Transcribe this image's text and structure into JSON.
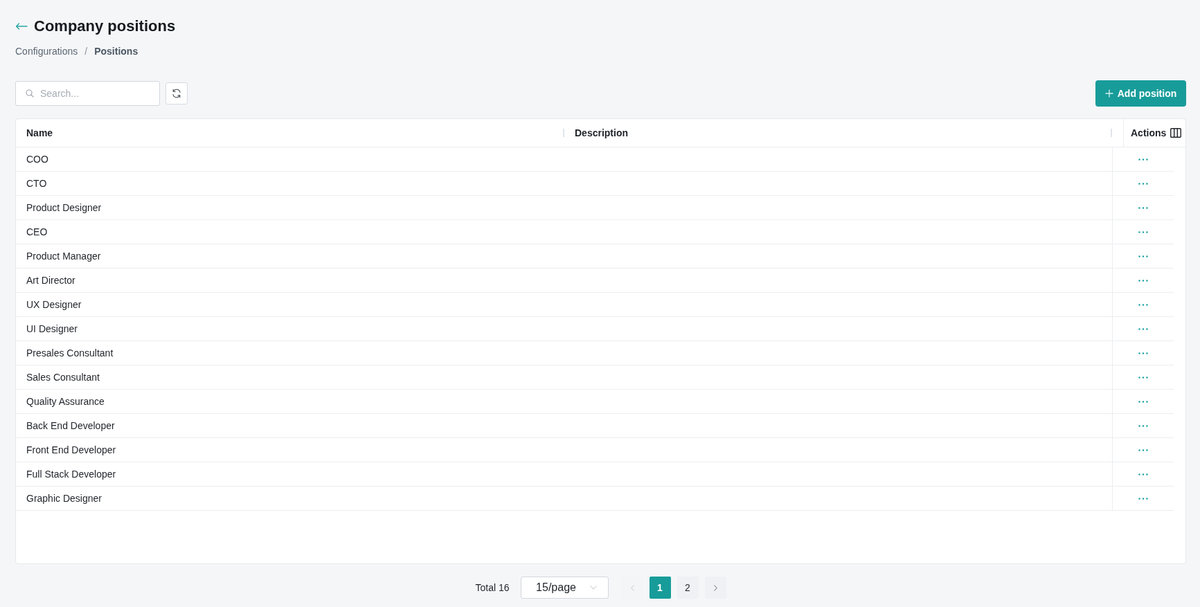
{
  "header": {
    "title": "Company positions"
  },
  "breadcrumb": {
    "items": [
      {
        "label": "Configurations",
        "current": false
      },
      {
        "label": "Positions",
        "current": true
      }
    ],
    "separator": "/"
  },
  "toolbar": {
    "search": {
      "placeholder": "Search..."
    },
    "add_button": "Add position"
  },
  "table": {
    "columns": [
      {
        "label": "Name"
      },
      {
        "label": "Description"
      },
      {
        "label": "Actions"
      }
    ],
    "rows": [
      {
        "name": "COO"
      },
      {
        "name": "CTO"
      },
      {
        "name": "Product Designer"
      },
      {
        "name": "CEO"
      },
      {
        "name": "Product Manager"
      },
      {
        "name": "Art Director"
      },
      {
        "name": "UX Designer"
      },
      {
        "name": "UI Designer"
      },
      {
        "name": "Presales Consultant"
      },
      {
        "name": "Sales Consultant"
      },
      {
        "name": "Quality Assurance"
      },
      {
        "name": "Back End Developer"
      },
      {
        "name": "Front End Developer"
      },
      {
        "name": "Full Stack Developer"
      },
      {
        "name": "Graphic Designer"
      }
    ]
  },
  "pagination": {
    "total": "Total 16",
    "page_size": "15/page",
    "prev": {
      "disabled": true
    },
    "pages": [
      {
        "label": "1",
        "selected": true
      },
      {
        "label": "2",
        "selected": false
      }
    ],
    "next": {
      "disabled": false
    }
  }
}
